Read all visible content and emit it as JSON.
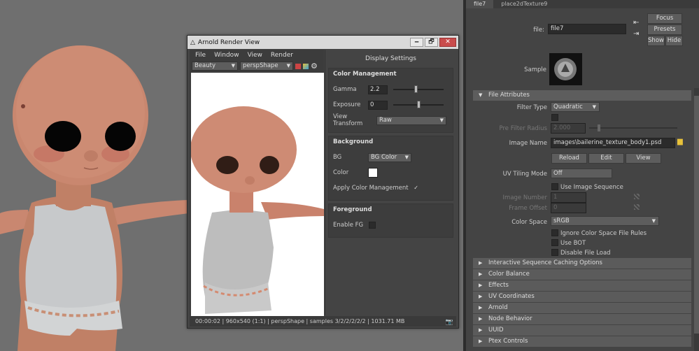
{
  "arnold": {
    "title": "Arnold Render View",
    "window_buttons": [
      "🗕",
      "🗗",
      "✕"
    ],
    "menu": [
      "File",
      "Window",
      "View",
      "Render"
    ],
    "aov": "Beauty",
    "camera": "perspShape",
    "display_settings_title": "Display Settings",
    "color_management": {
      "header": "Color Management",
      "gamma_label": "Gamma",
      "gamma_value": "2.2",
      "exposure_label": "Exposure",
      "exposure_value": "0",
      "view_transform_label": "View Transform",
      "view_transform_value": "Raw"
    },
    "background": {
      "header": "Background",
      "bg_label": "BG",
      "bg_value": "BG Color",
      "color_label": "Color",
      "apply_label": "Apply Color Management",
      "apply_check": "✓"
    },
    "foreground": {
      "header": "Foreground",
      "enable_label": "Enable FG"
    },
    "status": "00:00:02 | 960x540 (1:1) | perspShape  | samples 3/2/2/2/2/2 | 1031.71 MB"
  },
  "ae": {
    "tabs": [
      "file7",
      "place2dTexture9"
    ],
    "file_label": "file:",
    "file_value": "file7",
    "focus": "Focus",
    "presets": "Presets",
    "show": "Show",
    "hide": "Hide",
    "sample_label": "Sample",
    "file_attributes": "File Attributes",
    "filter_type_label": "Filter Type",
    "filter_type_value": "Quadratic",
    "pre_filter_label": "Pre Filter",
    "pre_filter_radius_label": "Pre Filter Radius",
    "pre_filter_radius_value": "2.000",
    "image_name_label": "Image Name",
    "image_name_value": "images\\bailerine_texture_body1.psd",
    "reload": "Reload",
    "edit": "Edit",
    "view": "View",
    "uv_tiling_label": "UV Tiling Mode",
    "uv_tiling_value": "Off",
    "use_image_sequence": "Use Image Sequence",
    "image_number_label": "Image Number",
    "image_number_value": "1",
    "frame_offset_label": "Frame Offset",
    "frame_offset_value": "0",
    "color_space_label": "Color Space",
    "color_space_value": "sRGB",
    "ignore_cs": "Ignore Color Space File Rules",
    "use_bot": "Use BOT",
    "disable_file_load": "Disable File Load",
    "sections": [
      "Interactive Sequence Caching Options",
      "Color Balance",
      "Effects",
      "UV Coordinates",
      "Arnold",
      "Node Behavior",
      "UUID",
      "Ptex Controls"
    ]
  }
}
